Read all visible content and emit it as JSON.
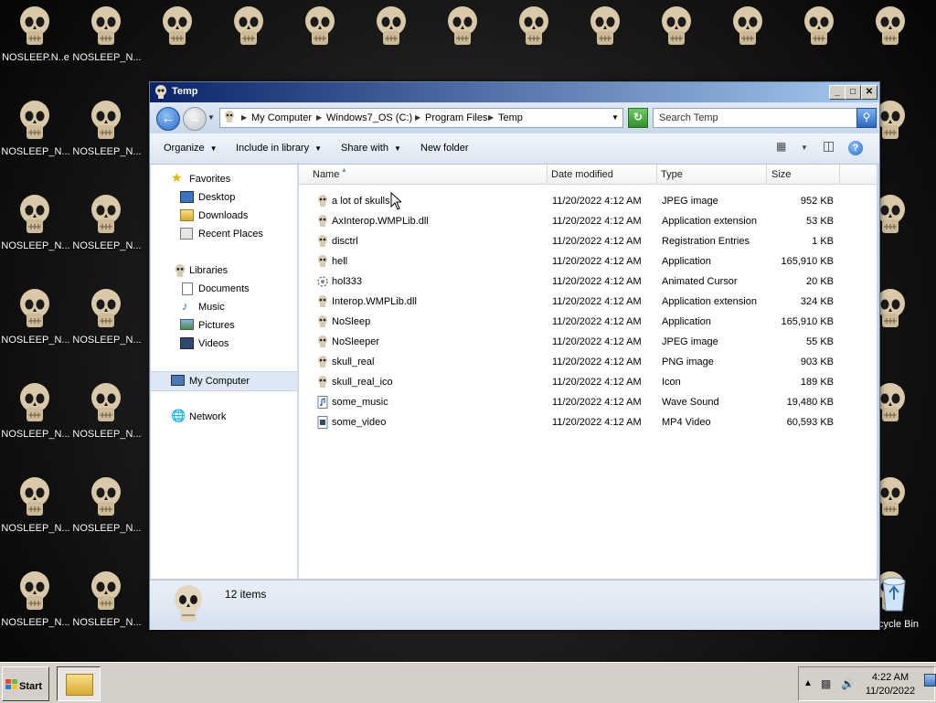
{
  "desktop": {
    "icon_label": "NOSLEEP_N...",
    "first_icon_label": "NOSLEEP.N..e",
    "recycle_label": "cycle Bin"
  },
  "window": {
    "title": "Temp",
    "controls": {
      "minimize": "_",
      "maximize": "□",
      "close": "✕"
    }
  },
  "address": {
    "crumbs": [
      "My Computer",
      "Windows7_OS (C:)",
      "Program Files",
      "Temp"
    ],
    "search_placeholder": "Search Temp"
  },
  "toolbar": {
    "organize": "Organize",
    "include_in_library": "Include in library",
    "share_with": "Share with",
    "new_folder": "New folder"
  },
  "nav": {
    "favorites": "Favorites",
    "desktop": "Desktop",
    "downloads": "Downloads",
    "recent_places": "Recent Places",
    "libraries": "Libraries",
    "documents": "Documents",
    "music": "Music",
    "pictures": "Pictures",
    "videos": "Videos",
    "my_computer": "My Computer",
    "network": "Network"
  },
  "columns": {
    "name": "Name",
    "date": "Date modified",
    "type": "Type",
    "size": "Size"
  },
  "files": [
    {
      "name": "a lot of skulls",
      "date": "11/20/2022 4:12 AM",
      "type": "JPEG image",
      "size": "952 KB",
      "icon": "skull-icon"
    },
    {
      "name": "AxInterop.WMPLib.dll",
      "date": "11/20/2022 4:12 AM",
      "type": "Application extension",
      "size": "53 KB",
      "icon": "skull-icon"
    },
    {
      "name": "disctrl",
      "date": "11/20/2022 4:12 AM",
      "type": "Registration Entries",
      "size": "1 KB",
      "icon": "skull-icon"
    },
    {
      "name": "hell",
      "date": "11/20/2022 4:12 AM",
      "type": "Application",
      "size": "165,910 KB",
      "icon": "skull-icon"
    },
    {
      "name": "hol333",
      "date": "11/20/2022 4:12 AM",
      "type": "Animated Cursor",
      "size": "20 KB",
      "icon": "animated-cursor-icon"
    },
    {
      "name": "Interop.WMPLib.dll",
      "date": "11/20/2022 4:12 AM",
      "type": "Application extension",
      "size": "324 KB",
      "icon": "skull-icon"
    },
    {
      "name": "NoSleep",
      "date": "11/20/2022 4:12 AM",
      "type": "Application",
      "size": "165,910 KB",
      "icon": "skull-icon"
    },
    {
      "name": "NoSleeper",
      "date": "11/20/2022 4:12 AM",
      "type": "JPEG image",
      "size": "55 KB",
      "icon": "skull-icon"
    },
    {
      "name": "skull_real",
      "date": "11/20/2022 4:12 AM",
      "type": "PNG image",
      "size": "903 KB",
      "icon": "skull-icon"
    },
    {
      "name": "skull_real_ico",
      "date": "11/20/2022 4:12 AM",
      "type": "Icon",
      "size": "189 KB",
      "icon": "skull-icon"
    },
    {
      "name": "some_music",
      "date": "11/20/2022 4:12 AM",
      "type": "Wave Sound",
      "size": "19,480 KB",
      "icon": "audio-file-icon"
    },
    {
      "name": "some_video",
      "date": "11/20/2022 4:12 AM",
      "type": "MP4 Video",
      "size": "60,593 KB",
      "icon": "video-file-icon"
    }
  ],
  "details": {
    "count": "12 items"
  },
  "taskbar": {
    "start": "Start",
    "time": "4:22 AM",
    "date": "11/20/2022"
  }
}
